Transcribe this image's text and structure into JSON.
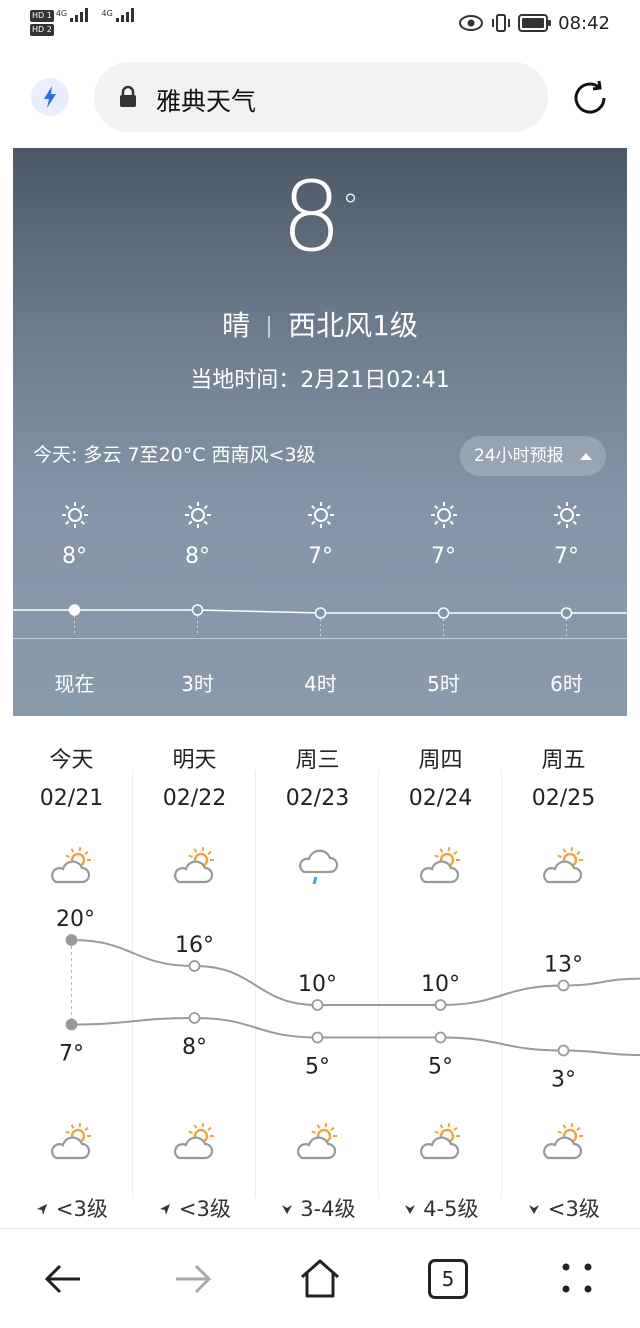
{
  "status_bar": {
    "hd1": "HD 1",
    "hd2": "HD 2",
    "net1": "4G",
    "net2": "4G",
    "time": "08:42"
  },
  "address_bar": {
    "url_text": "雅典天气"
  },
  "current": {
    "temperature": "8",
    "degree_symbol": "°",
    "condition": "晴",
    "wind": "西北风1级",
    "local_time": "当地时间：2月21日02:41"
  },
  "today_summary": "今天: 多云  7至20°C  西南风<3级",
  "forecast_button": "24小时预报",
  "hourly": [
    {
      "label": "现在",
      "temp": "8°",
      "value": 8
    },
    {
      "label": "3时",
      "temp": "8°",
      "value": 8
    },
    {
      "label": "4时",
      "temp": "7°",
      "value": 7
    },
    {
      "label": "5时",
      "temp": "7°",
      "value": 7
    },
    {
      "label": "6时",
      "temp": "7°",
      "value": 7
    }
  ],
  "daily": [
    {
      "day": "今天",
      "date": "02/21",
      "icon": "partly-cloudy-icon",
      "high": "20°",
      "low": "7°",
      "night_icon": "partly-cloudy-icon",
      "wind": "<3级"
    },
    {
      "day": "明天",
      "date": "02/22",
      "icon": "partly-cloudy-icon",
      "high": "16°",
      "low": "8°",
      "night_icon": "partly-cloudy-icon",
      "wind": "<3级"
    },
    {
      "day": "周三",
      "date": "02/23",
      "icon": "rain-icon",
      "high": "10°",
      "low": "5°",
      "night_icon": "partly-cloudy-icon",
      "wind": "3-4级"
    },
    {
      "day": "周四",
      "date": "02/24",
      "icon": "partly-cloudy-icon",
      "high": "10°",
      "low": "5°",
      "night_icon": "partly-cloudy-icon",
      "wind": "4-5级"
    },
    {
      "day": "周五",
      "date": "02/25",
      "icon": "partly-cloudy-icon",
      "high": "13°",
      "low": "3°",
      "night_icon": "partly-cloudy-icon",
      "wind": "<3级"
    }
  ],
  "tab_count": "5",
  "colors": {
    "accent": "#2f6fe0",
    "sun": "#f3a43a",
    "rain": "#3aa7e6",
    "curve": "#9a9a9a"
  }
}
